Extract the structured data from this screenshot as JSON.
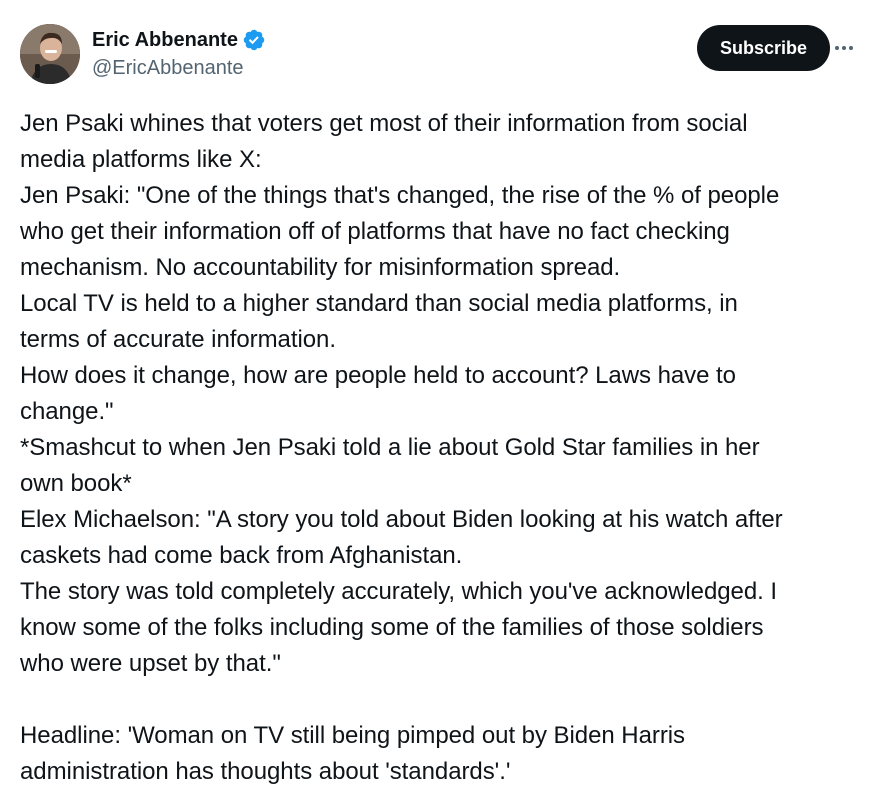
{
  "author": {
    "display_name": "Eric Abbenante",
    "handle": "@EricAbbenante",
    "verified_icon": "verified-badge-icon",
    "avatar_icon": "avatar-photo"
  },
  "actions": {
    "subscribe_label": "Subscribe",
    "more_icon": "more-dots-icon"
  },
  "colors": {
    "text": "#0f1419",
    "secondary": "#536471",
    "verified": "#1d9bf0",
    "button_bg": "#0f1419"
  },
  "tweet": {
    "lines": [
      "Jen Psaki whines that voters get most of their information from social",
      "media platforms like X:",
      "Jen Psaki: \"One of the things that's changed, the rise of the % of people",
      "who get their information off of platforms that have no fact checking",
      "mechanism. No accountability for misinformation spread.",
      "Local TV is held to a higher standard than social media platforms, in",
      "terms of accurate information.",
      "How does it change, how are people held to account? Laws have to",
      "change.\"",
      "*Smashcut to when Jen Psaki told a lie about Gold Star families in her",
      "own book*",
      "Elex Michaelson: \"A story you told about Biden looking at his watch after",
      "caskets had come back from Afghanistan.",
      "The story was told completely accurately, which you've acknowledged. I",
      "know some of the folks including some of the families of those soldiers",
      "who were upset by that.\"",
      "",
      "Headline: 'Woman on TV still being pimped out by Biden Harris",
      "administration has thoughts about 'standards'.'"
    ]
  }
}
